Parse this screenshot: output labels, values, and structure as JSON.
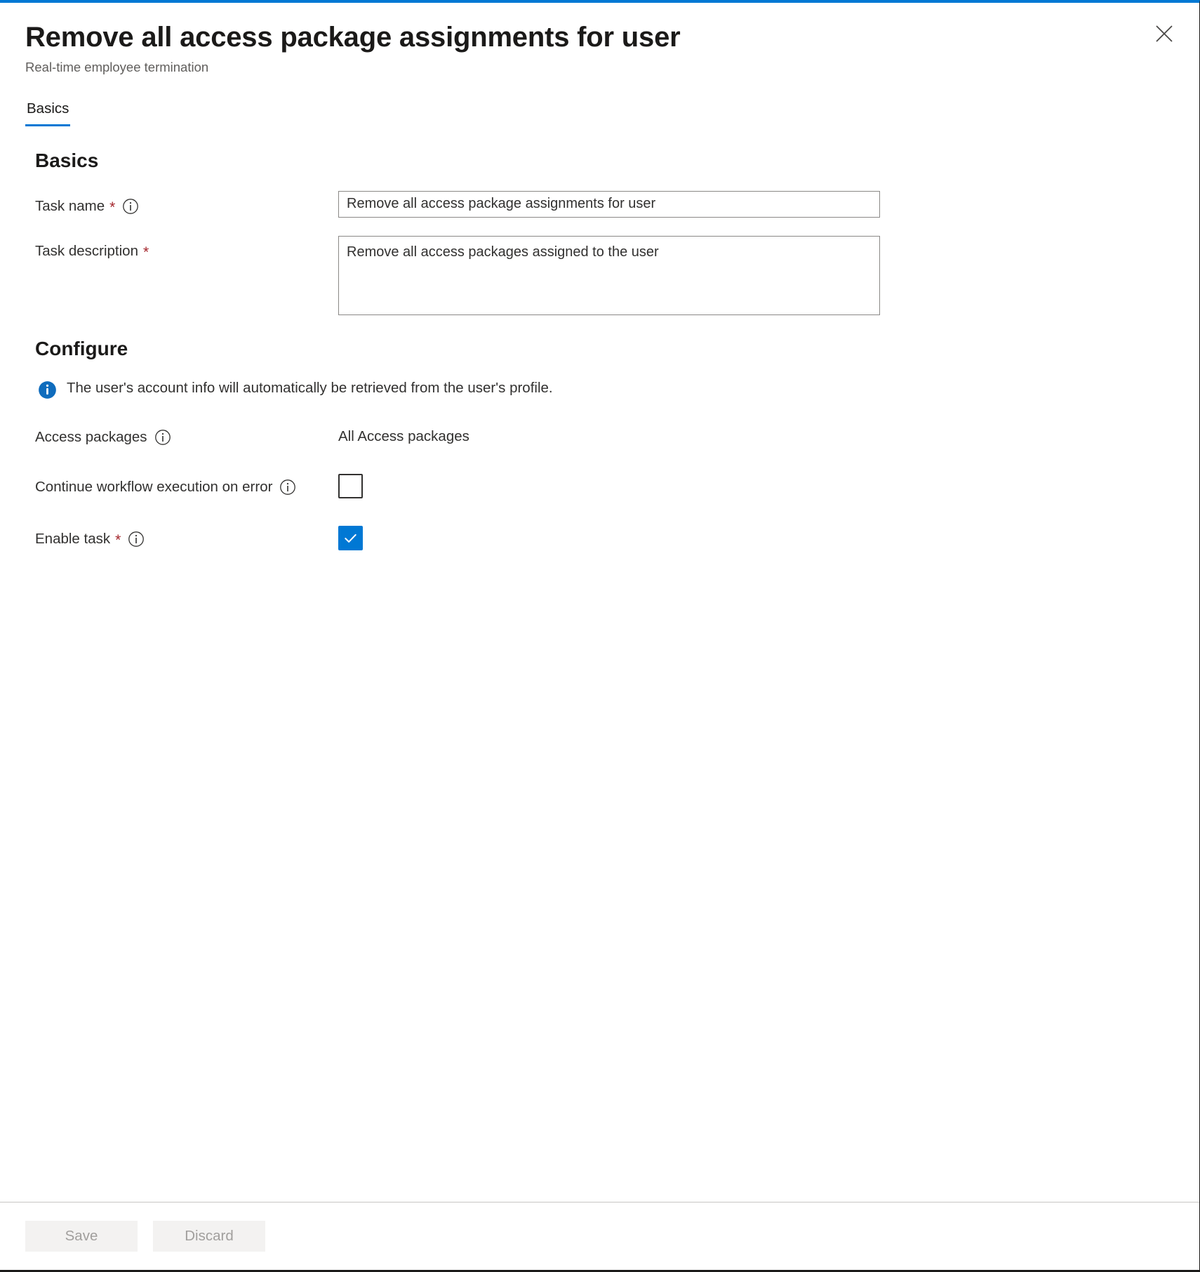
{
  "blade": {
    "title": "Remove all access package assignments for user",
    "subtitle": "Real-time employee termination",
    "close_label": "Close"
  },
  "tabs": [
    {
      "label": "Basics",
      "selected": true
    }
  ],
  "sections": {
    "basics": {
      "heading": "Basics",
      "task_name": {
        "label": "Task name",
        "required_marker": "*",
        "value": "Remove all access package assignments for user"
      },
      "task_description": {
        "label": "Task description",
        "required_marker": "*",
        "value": "Remove all access packages assigned to the user"
      }
    },
    "configure": {
      "heading": "Configure",
      "info_message": "The user's account info will automatically be retrieved from the user's profile.",
      "access_packages": {
        "label": "Access packages",
        "value": "All Access packages"
      },
      "continue_on_error": {
        "label": "Continue workflow execution on error",
        "checked": false
      },
      "enable_task": {
        "label": "Enable task",
        "required_marker": "*",
        "checked": true
      }
    }
  },
  "footer": {
    "save_label": "Save",
    "discard_label": "Discard"
  },
  "colors": {
    "accent": "#0078d4",
    "required": "#a4262c",
    "input_border": "#8a8886",
    "disabled_button_bg": "#f3f2f1",
    "disabled_button_text": "#a19f9d"
  }
}
